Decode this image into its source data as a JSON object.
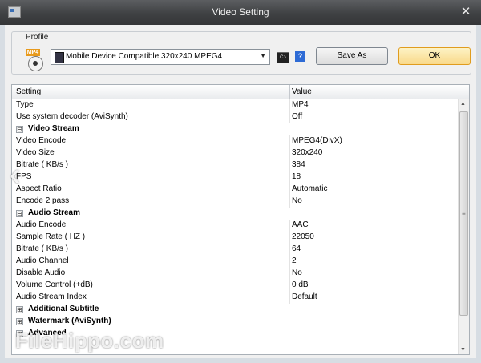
{
  "window": {
    "title": "Video Setting",
    "close_label": "✕"
  },
  "profile": {
    "legend": "Profile",
    "icon_tag": "MP4",
    "selected": "Mobile Device Compatible 320x240 MPEG4",
    "cmd_label": "C:\\",
    "help_label": "?",
    "save_as_label": "Save As",
    "ok_label": "OK"
  },
  "grid": {
    "header": {
      "setting": "Setting",
      "value": "Value"
    },
    "rows": [
      {
        "type": "item",
        "label": "Type",
        "value": "MP4"
      },
      {
        "type": "item",
        "label": "Use system decoder (AviSynth)",
        "value": "Off"
      },
      {
        "type": "group",
        "label": "Video Stream",
        "expander": "⊟"
      },
      {
        "type": "item",
        "label": "Video Encode",
        "value": "MPEG4(DivX)"
      },
      {
        "type": "item",
        "label": "Video Size",
        "value": "320x240"
      },
      {
        "type": "item",
        "label": "Bitrate ( KB/s )",
        "value": "384"
      },
      {
        "type": "item",
        "label": "FPS",
        "value": "18"
      },
      {
        "type": "item",
        "label": "Aspect Ratio",
        "value": "Automatic"
      },
      {
        "type": "item",
        "label": "Encode 2 pass",
        "value": "No"
      },
      {
        "type": "group",
        "label": "Audio Stream",
        "expander": "⊟"
      },
      {
        "type": "item",
        "label": "Audio Encode",
        "value": "AAC"
      },
      {
        "type": "item",
        "label": "Sample Rate ( HZ )",
        "value": "22050"
      },
      {
        "type": "item",
        "label": "Bitrate ( KB/s )",
        "value": "64"
      },
      {
        "type": "item",
        "label": "Audio Channel",
        "value": "2"
      },
      {
        "type": "item",
        "label": "Disable Audio",
        "value": "No"
      },
      {
        "type": "item",
        "label": "Volume Control (+dB)",
        "value": "0 dB"
      },
      {
        "type": "item",
        "label": "Audio Stream Index",
        "value": "Default"
      },
      {
        "type": "group",
        "label": "Additional Subtitle",
        "expander": "⊞"
      },
      {
        "type": "group",
        "label": "Watermark (AviSynth)",
        "expander": "⊞"
      },
      {
        "type": "group",
        "label": "Advanced",
        "expander": "⊞"
      }
    ]
  },
  "overlay": {
    "watermark": "FileHippo.com",
    "nav_prev": "‹"
  },
  "colors": {
    "titlebar": "#3f4143",
    "ok_border": "#e09c1e",
    "client_bg": "#f0f0f0"
  }
}
